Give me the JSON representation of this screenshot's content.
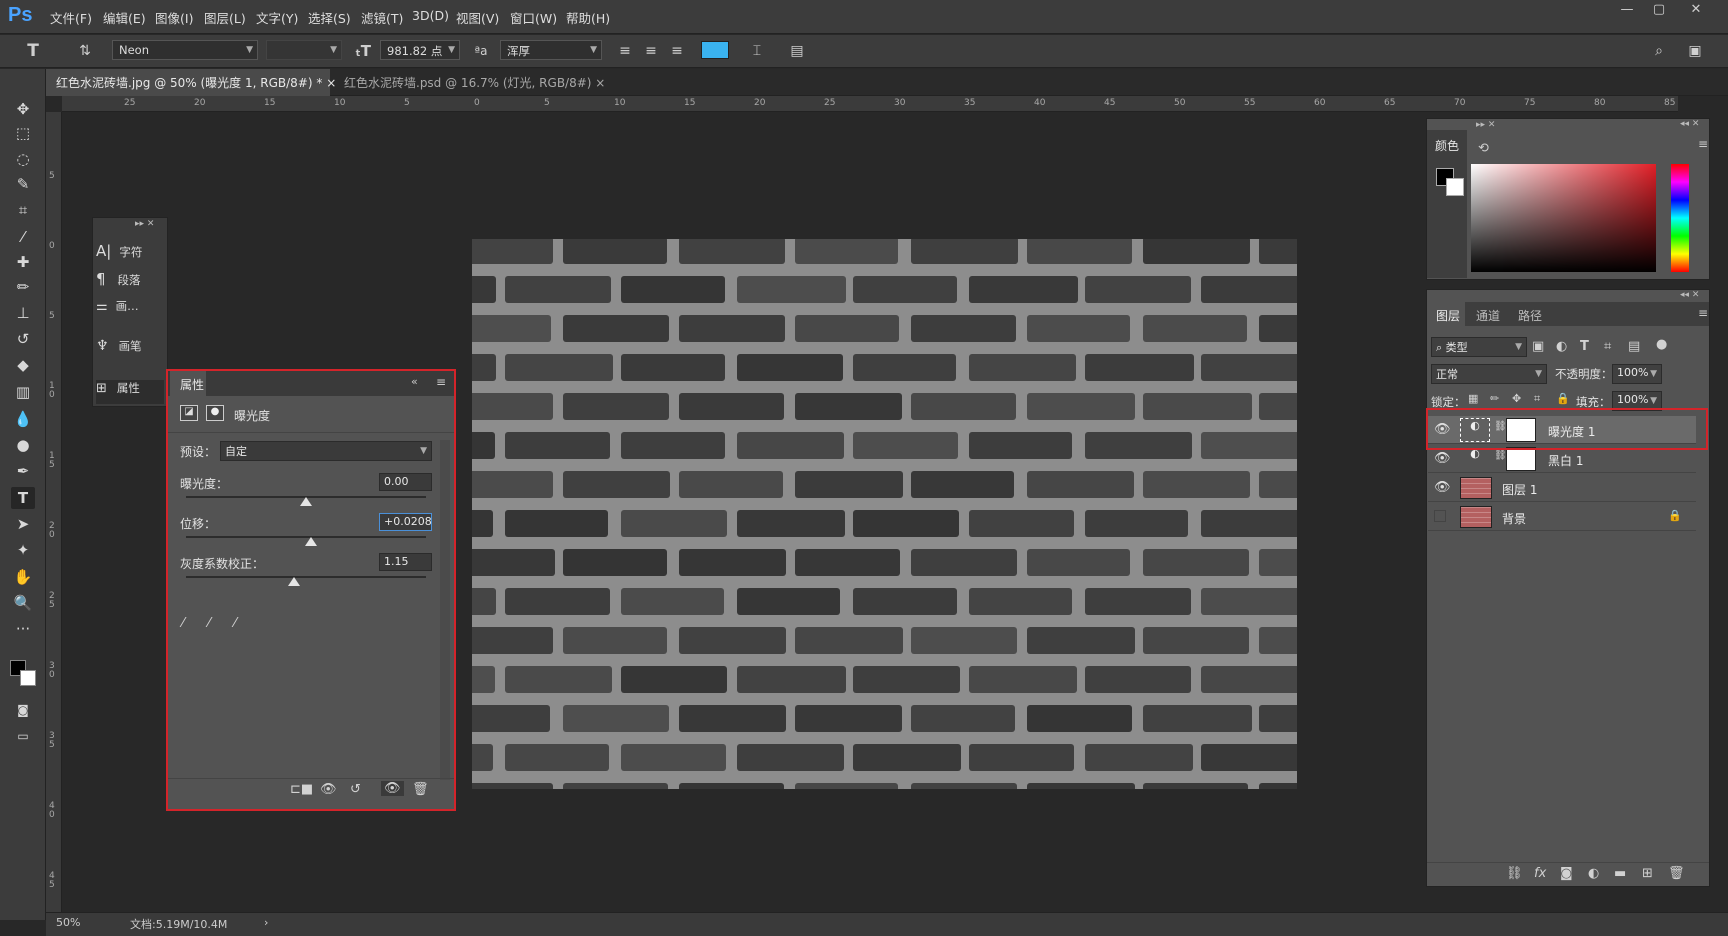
{
  "app": {
    "logo": "Ps"
  },
  "menu": [
    "文件(F)",
    "编辑(E)",
    "图像(I)",
    "图层(L)",
    "文字(Y)",
    "选择(S)",
    "滤镜(T)",
    "3D(D)",
    "视图(V)",
    "窗口(W)",
    "帮助(H)"
  ],
  "window_controls": {
    "minimize": "—",
    "maximize": "▢",
    "close": "✕"
  },
  "options": {
    "font_family": "Neon",
    "font_size": "981.82 点",
    "aa_icon": "ªa",
    "antialias": "浑厚",
    "text_color": "#3ab3f0"
  },
  "tabs": [
    {
      "label": "红色水泥砖墙.jpg @ 50% (曝光度 1, RGB/8#) *",
      "close": "×"
    },
    {
      "label": "红色水泥砖墙.psd @ 16.7% (灯光, RGB/8#)",
      "close": "×"
    }
  ],
  "ruler_top": [
    "25",
    "20",
    "15",
    "10",
    "5",
    "0",
    "5",
    "10",
    "15",
    "20",
    "25",
    "30",
    "35",
    "40",
    "45",
    "50",
    "55",
    "60",
    "65",
    "70",
    "75",
    "80",
    "85"
  ],
  "ruler_left": [
    "5",
    "0",
    "5",
    "1 0",
    "1 5",
    "2 0",
    "2 5",
    "3 0",
    "3 5",
    "4 0",
    "4 5"
  ],
  "mini_panel": {
    "items": [
      "字符",
      "段落",
      "画…",
      "画笔",
      "属性"
    ]
  },
  "properties": {
    "tab": "属性",
    "title": "曝光度",
    "preset_label": "预设：",
    "preset_value": "自定",
    "exposure_label": "曝光度：",
    "exposure_value": "0.00",
    "exposure_level": 0.5,
    "offset_label": "位移：",
    "offset_value": "+0.0208",
    "offset_level": 0.52,
    "gamma_label": "灰度系数校正：",
    "gamma_value": "1.15",
    "gamma_level": 0.45
  },
  "color_panel": {
    "tab": "颜色",
    "fg": "#000000",
    "bg": "#ffffff"
  },
  "layers_panel": {
    "tabs": [
      "图层",
      "通道",
      "路径"
    ],
    "filter": "类型",
    "blend_mode": "正常",
    "opacity_label": "不透明度：",
    "opacity_value": "100%",
    "lock_label": "锁定：",
    "fill_label": "填充：",
    "fill_value": "100%",
    "layers": [
      {
        "name": "曝光度 1",
        "kind": "adjustment",
        "visible": true,
        "selected": true
      },
      {
        "name": "黑白 1",
        "kind": "adjustment",
        "visible": true,
        "selected": false
      },
      {
        "name": "图层 1",
        "kind": "image",
        "visible": true,
        "selected": false
      },
      {
        "name": "背景",
        "kind": "image",
        "visible": false,
        "selected": false,
        "locked": true
      }
    ]
  },
  "status": {
    "zoom": "50%",
    "doc": "文档:5.19M/10.4M"
  }
}
